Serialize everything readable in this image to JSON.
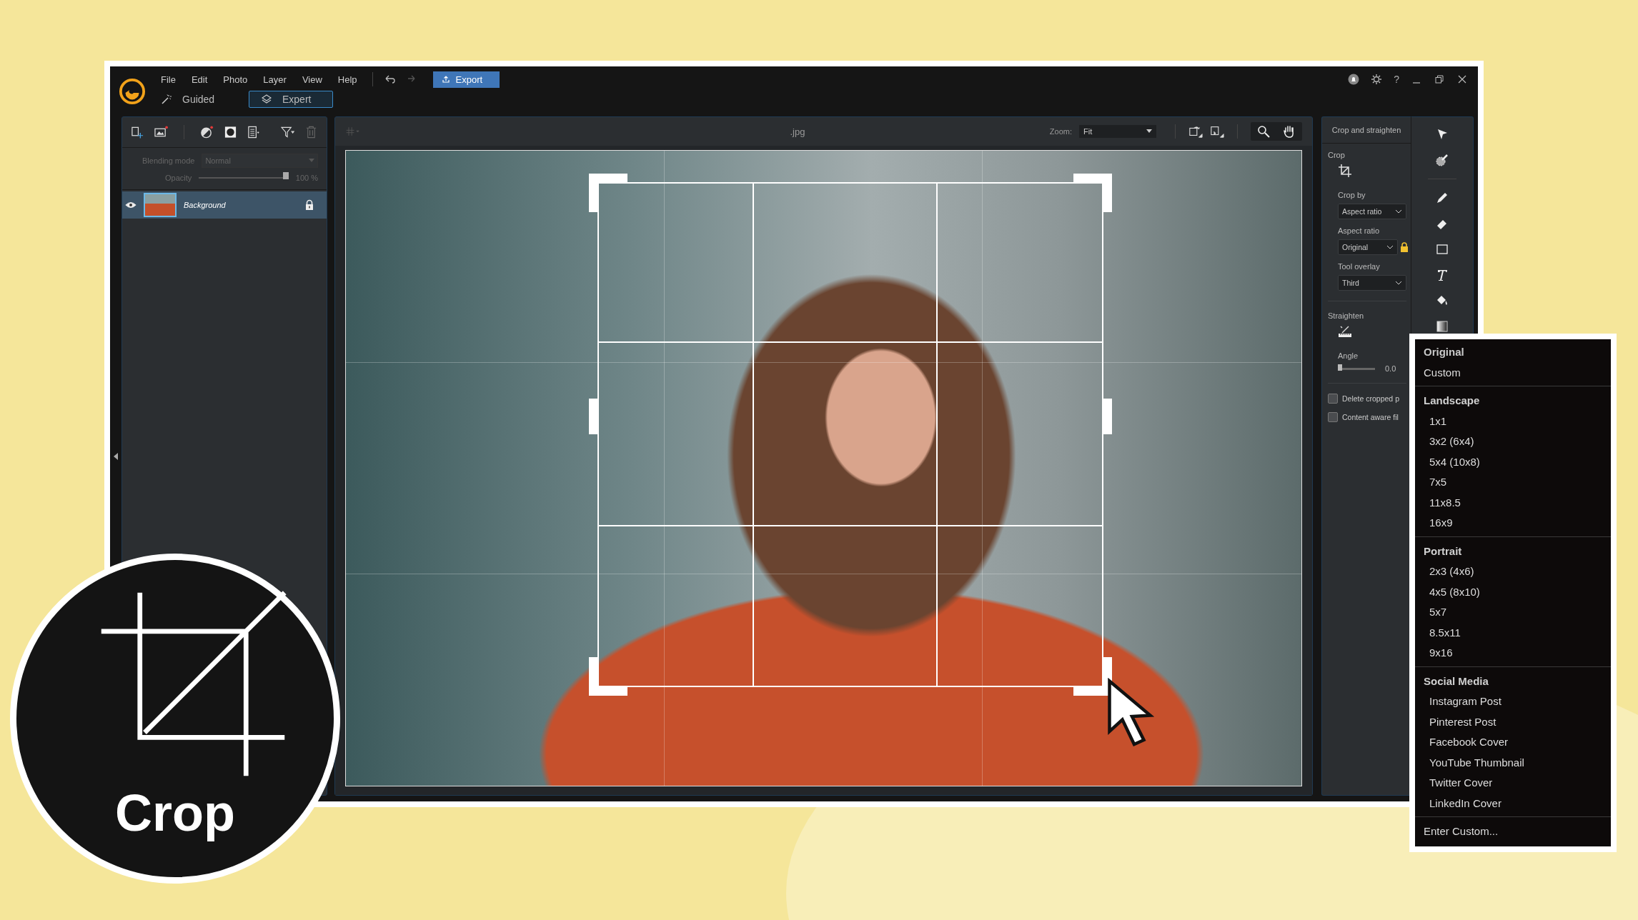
{
  "app": {
    "menu": [
      "File",
      "Edit",
      "Photo",
      "Layer",
      "View",
      "Help"
    ],
    "export_button": "Export",
    "help_button": "?",
    "modes": [
      {
        "kind": "guided",
        "label": "Guided",
        "selected": false
      },
      {
        "kind": "expert",
        "label": "Expert",
        "selected": true
      }
    ]
  },
  "layers_panel": {
    "blending_mode_label": "Blending mode",
    "blending_mode": "Normal",
    "opacity_label": "Opacity",
    "opacity": {
      "level": 1
    },
    "opacity_reading": "100 %",
    "layers": [
      {
        "name": "Background",
        "visible": true,
        "locked": true,
        "selected": true
      }
    ]
  },
  "canvas": {
    "file_name": ".jpg",
    "zoom_label": "Zoom:",
    "zoom": "Fit"
  },
  "crop_panel": {
    "title": "Crop and straighten",
    "crop_label": "Crop",
    "crop_by_label": "Crop by",
    "crop_by": "Aspect ratio",
    "aspect_ratio_label": "Aspect ratio",
    "aspect_ratio": "Original",
    "aspect_locked": true,
    "tool_overlay_label": "Tool overlay",
    "tool_overlay": "Third",
    "straighten_label": "Straighten",
    "angle_label": "Angle",
    "angle": {
      "level": 0
    },
    "angle_reading": "0.0",
    "options": [
      {
        "label": "Delete cropped p",
        "checked": false
      },
      {
        "label": "Content aware fil",
        "checked": false
      }
    ]
  },
  "aspect_menu": {
    "sections": [
      {
        "items": [
          {
            "label": "Original",
            "selected": true
          },
          {
            "label": "Custom",
            "selected": false
          }
        ]
      },
      {
        "heading": "Landscape",
        "items": [
          {
            "label": "1x1",
            "selected": false
          },
          {
            "label": "3x2 (6x4)",
            "selected": false
          },
          {
            "label": "5x4 (10x8)",
            "selected": false
          },
          {
            "label": "7x5",
            "selected": false
          },
          {
            "label": "11x8.5",
            "selected": false
          },
          {
            "label": "16x9",
            "selected": false
          }
        ]
      },
      {
        "heading": "Portrait",
        "items": [
          {
            "label": "2x3 (4x6)",
            "selected": false
          },
          {
            "label": "4x5 (8x10)",
            "selected": false
          },
          {
            "label": "5x7",
            "selected": false
          },
          {
            "label": "8.5x11",
            "selected": false
          },
          {
            "label": "9x16",
            "selected": false
          }
        ]
      },
      {
        "heading": "Social Media",
        "items": [
          {
            "label": "Instagram Post",
            "selected": false
          },
          {
            "label": "Pinterest Post",
            "selected": false
          },
          {
            "label": "Facebook Cover",
            "selected": false
          },
          {
            "label": "YouTube Thumbnail",
            "selected": false
          },
          {
            "label": "Twitter Cover",
            "selected": false
          },
          {
            "label": "LinkedIn Cover",
            "selected": false
          }
        ]
      },
      {
        "items": [
          {
            "label": "Enter Custom...",
            "selected": false
          }
        ]
      }
    ]
  },
  "badge": {
    "label": "Crop"
  }
}
